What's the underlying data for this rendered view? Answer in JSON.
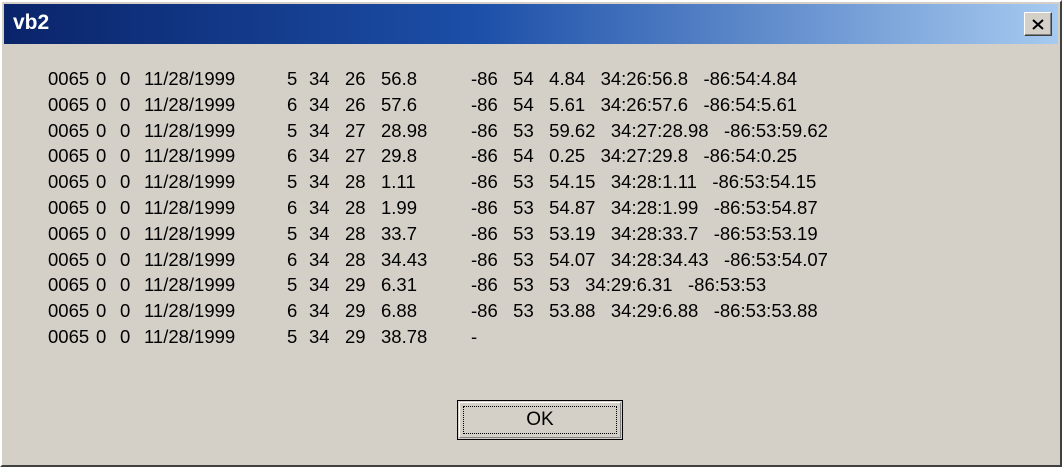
{
  "window": {
    "title": "vb2",
    "close_icon": "close-icon"
  },
  "output_rows": [
    {
      "cols": [
        "0065",
        "0",
        "0",
        "11/28/1999",
        "5",
        "34",
        "26",
        "56.8"
      ],
      "rest": "-86   54   4.84   34:26:56.8   -86:54:4.84"
    },
    {
      "cols": [
        "0065",
        "0",
        "0",
        "11/28/1999",
        "6",
        "34",
        "26",
        "57.6"
      ],
      "rest": "-86   54   5.61   34:26:57.6   -86:54:5.61"
    },
    {
      "cols": [
        "0065",
        "0",
        "0",
        "11/28/1999",
        "5",
        "34",
        "27",
        "28.98"
      ],
      "rest": "-86   53   59.62   34:27:28.98   -86:53:59.62"
    },
    {
      "cols": [
        "0065",
        "0",
        "0",
        "11/28/1999",
        "6",
        "34",
        "27",
        "29.8"
      ],
      "rest": "-86   54   0.25   34:27:29.8   -86:54:0.25"
    },
    {
      "cols": [
        "0065",
        "0",
        "0",
        "11/28/1999",
        "5",
        "34",
        "28",
        "1.11"
      ],
      "rest": "-86   53   54.15   34:28:1.11   -86:53:54.15"
    },
    {
      "cols": [
        "0065",
        "0",
        "0",
        "11/28/1999",
        "6",
        "34",
        "28",
        "1.99"
      ],
      "rest": "-86   53   54.87   34:28:1.99   -86:53:54.87"
    },
    {
      "cols": [
        "0065",
        "0",
        "0",
        "11/28/1999",
        "5",
        "34",
        "28",
        "33.7"
      ],
      "rest": "-86   53   53.19   34:28:33.7   -86:53:53.19"
    },
    {
      "cols": [
        "0065",
        "0",
        "0",
        "11/28/1999",
        "6",
        "34",
        "28",
        "34.43"
      ],
      "rest": "-86   53   54.07   34:28:34.43   -86:53:54.07"
    },
    {
      "cols": [
        "0065",
        "0",
        "0",
        "11/28/1999",
        "5",
        "34",
        "29",
        "6.31"
      ],
      "rest": "-86   53   53   34:29:6.31   -86:53:53"
    },
    {
      "cols": [
        "0065",
        "0",
        "0",
        "11/28/1999",
        "6",
        "34",
        "29",
        "6.88"
      ],
      "rest": "-86   53   53.88   34:29:6.88   -86:53:53.88"
    },
    {
      "cols": [
        "0065",
        "0",
        "0",
        "11/28/1999",
        "5",
        "34",
        "29",
        "38.78"
      ],
      "rest": "-"
    }
  ],
  "ok_button": {
    "label": "OK"
  },
  "colors": {
    "face": "#d4d0c8",
    "title_start": "#0a246a",
    "title_end": "#a6caf0"
  }
}
